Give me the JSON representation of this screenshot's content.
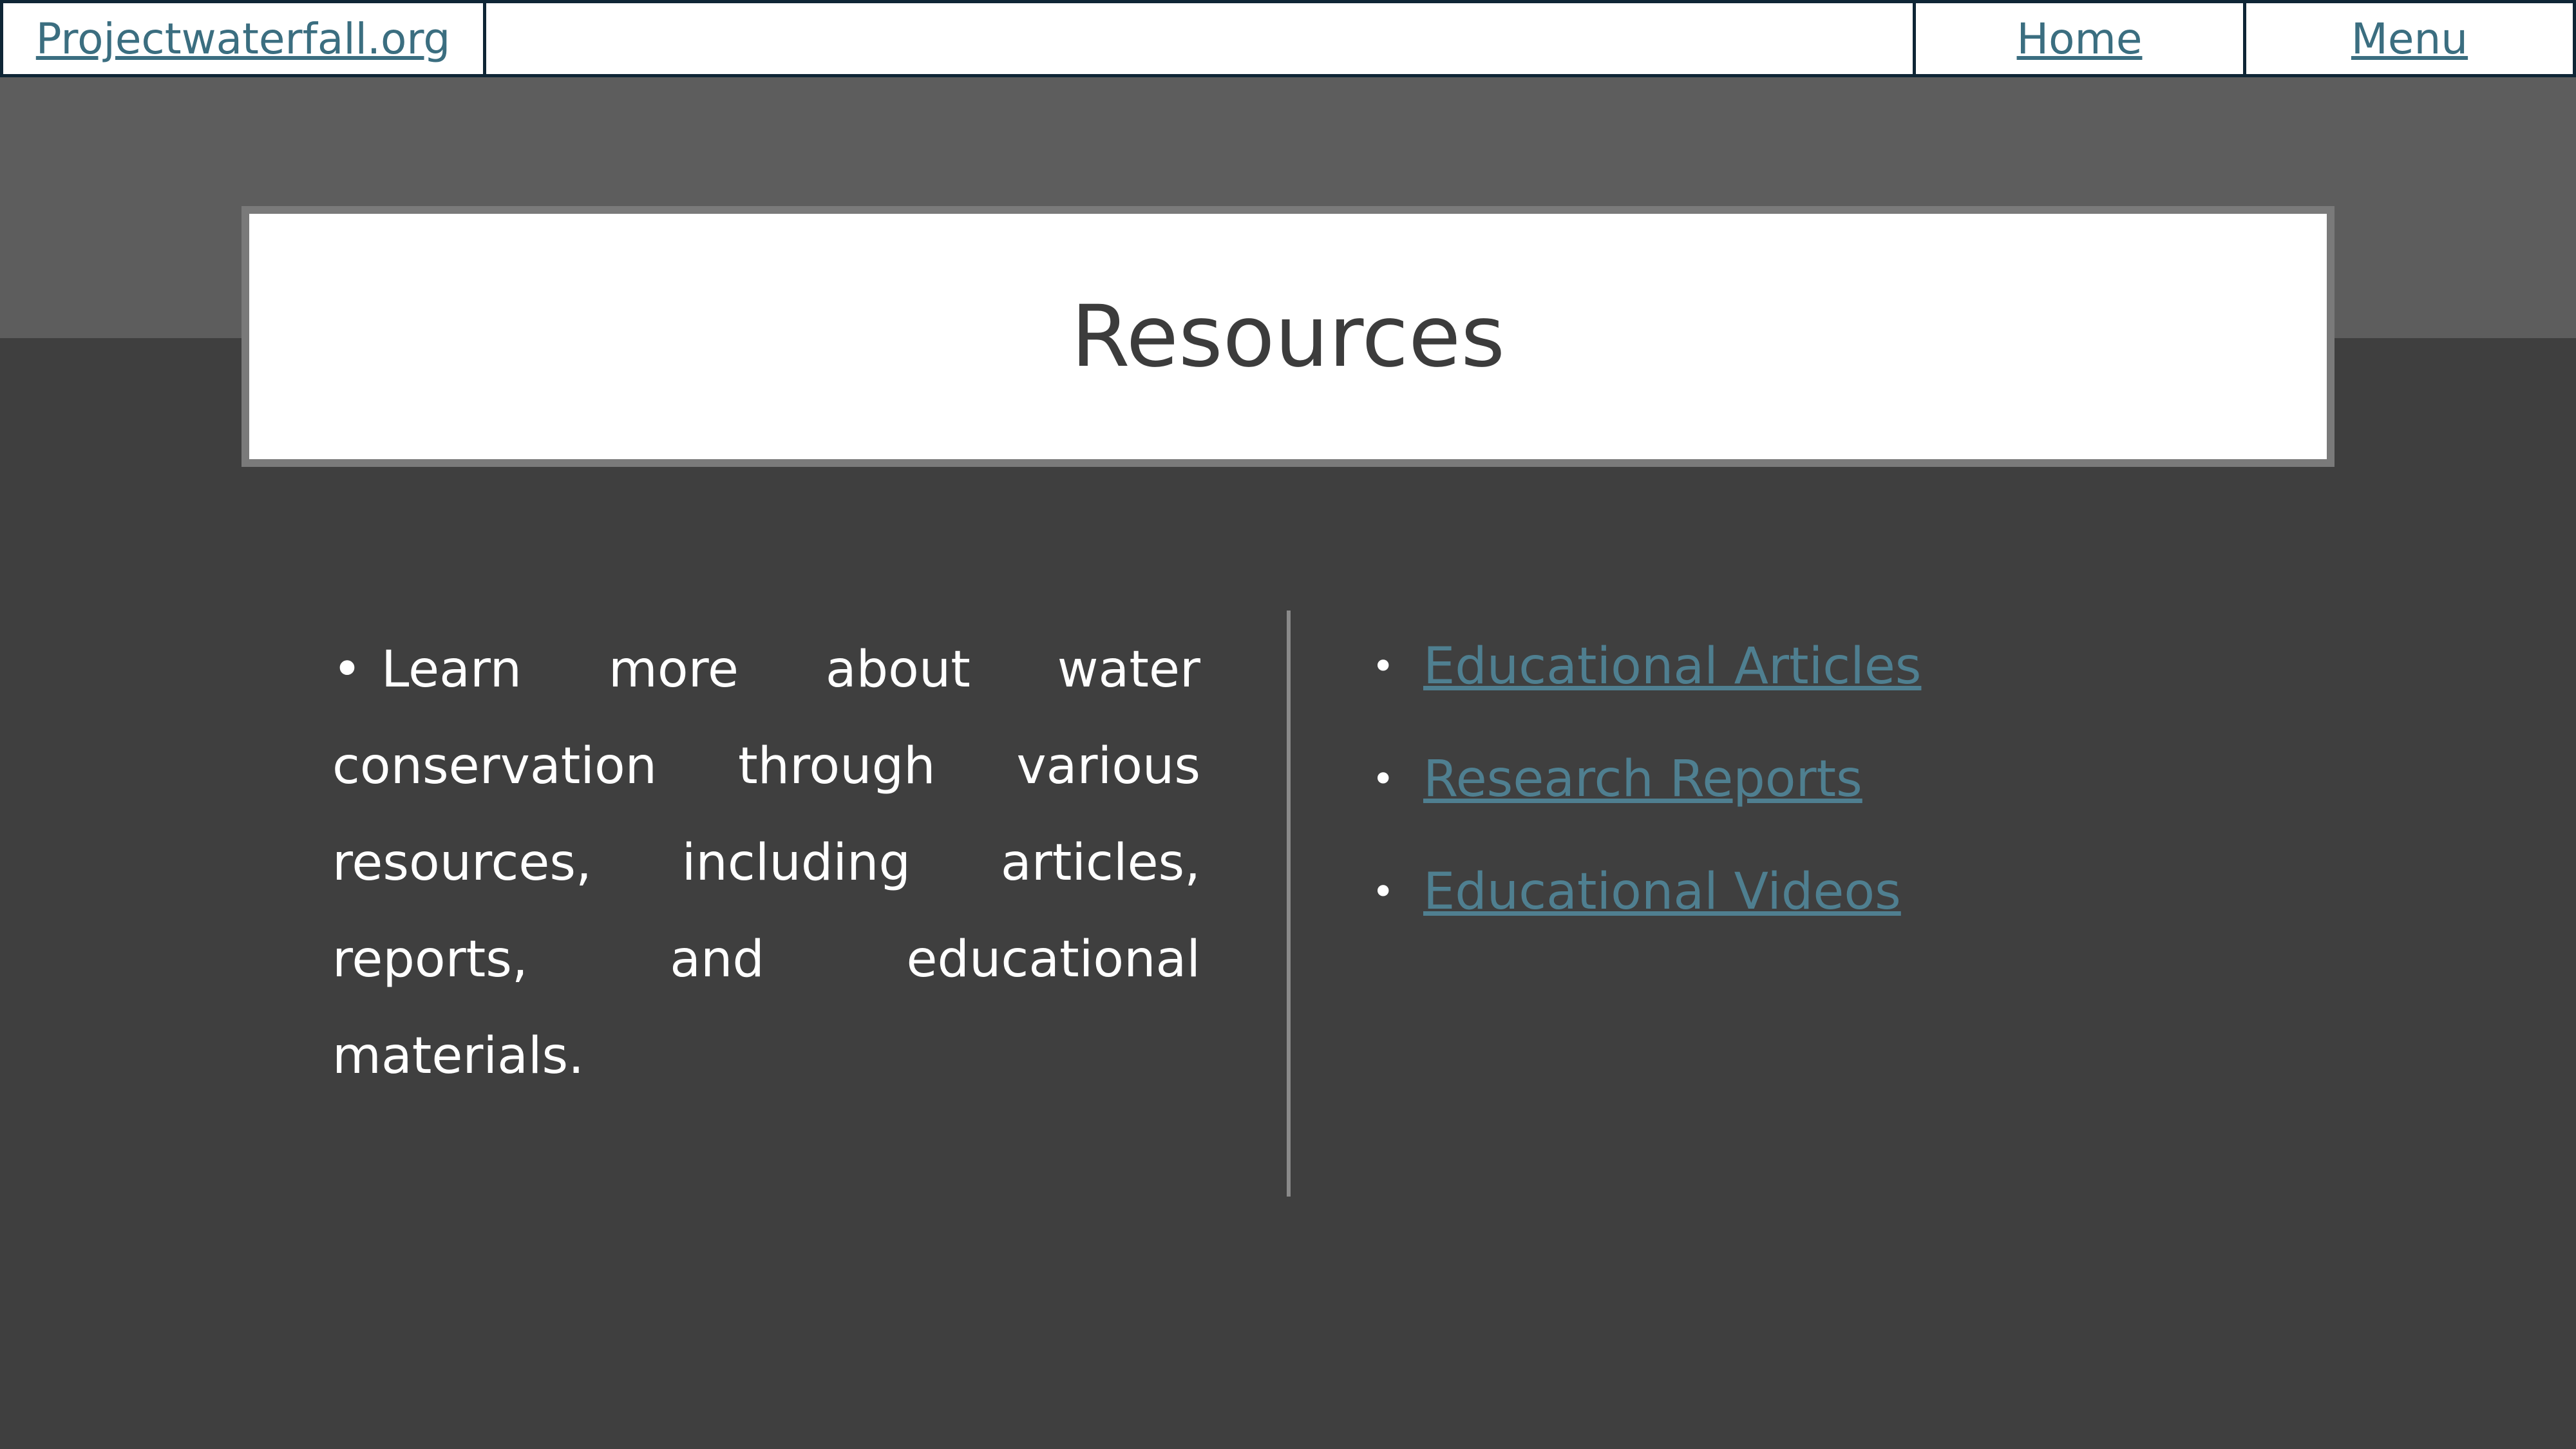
{
  "nav": {
    "site_link": "Projectwaterfall.org",
    "home_link": "Home",
    "menu_link": "Menu"
  },
  "title": "Resources",
  "left": {
    "bullet": "•",
    "text": "Learn more about water conservation through various resources, including articles, reports, and educational materials."
  },
  "right": {
    "bullet": "•",
    "links": [
      "Educational Articles",
      "Research Reports",
      "Educational Videos"
    ]
  },
  "colors": {
    "link": "#3b6e80",
    "background": "#3f3f3f",
    "band": "#5d5d5d",
    "nav_border": "#0f2636"
  }
}
